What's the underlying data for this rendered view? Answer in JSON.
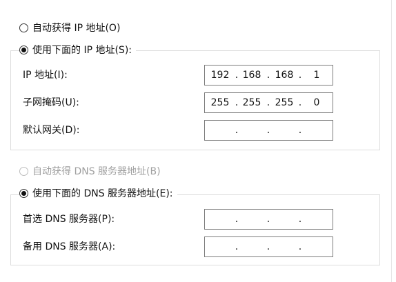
{
  "auto_ip": {
    "label": "自动获得 IP 地址(O)",
    "checked": false
  },
  "manual_ip": {
    "label": "使用下面的 IP 地址(S):",
    "checked": true,
    "fields": [
      {
        "label": "IP 地址(I):",
        "octets": [
          "192",
          "168",
          "168",
          "1"
        ]
      },
      {
        "label": "子网掩码(U):",
        "octets": [
          "255",
          "255",
          "255",
          "0"
        ]
      },
      {
        "label": "默认网关(D):",
        "octets": [
          "",
          "",
          "",
          ""
        ]
      }
    ]
  },
  "auto_dns": {
    "label": "自动获得 DNS 服务器地址(B)",
    "checked": false,
    "disabled": true
  },
  "manual_dns": {
    "label": "使用下面的 DNS 服务器地址(E):",
    "checked": true,
    "fields": [
      {
        "label": "首选 DNS 服务器(P):",
        "octets": [
          "",
          "",
          "",
          ""
        ]
      },
      {
        "label": "备用 DNS 服务器(A):",
        "octets": [
          "",
          "",
          "",
          ""
        ]
      }
    ]
  },
  "ip_separator": "."
}
